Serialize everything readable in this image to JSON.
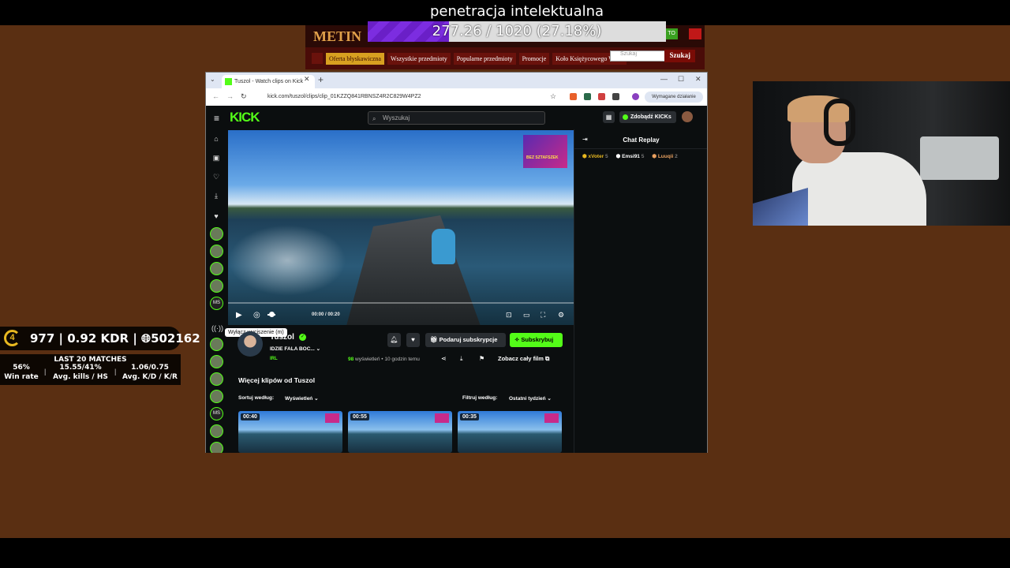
{
  "stream_title": "penetracja intelektualna",
  "goal": {
    "text": "277.26 / 1020 (27.18%)",
    "progress_percent": 27.18
  },
  "shop": {
    "logo": "METIN",
    "nav": [
      "Oferta błyskawiczna",
      "Wszystkie przedmioty",
      "Popularne przedmioty",
      "Promocje",
      "Koło Księżycowego Wilka"
    ],
    "search_placeholder": "Szukaj",
    "search_button": "Szukaj",
    "green_badge": "TO"
  },
  "browser": {
    "tab_title": "Tuszol - Watch clips on Kick",
    "url": "kick.com/tuszol/clips/clip_01KZZQ841RBNSZ4R2C829W4PZ2",
    "required_action": "Wymagane działanie"
  },
  "kick": {
    "logo": "KICK",
    "search_placeholder": "Wyszukaj",
    "get_kicks": "Zdobądź KICKs",
    "tooltip": "Wyłącz wyciszenie (m)",
    "time": "00:00 / 00:20",
    "ad_text": "BEZ SZTAFSZEK",
    "chat_title": "Chat Replay",
    "chat_badges": [
      {
        "name": "xVoter",
        "count": "5",
        "color": "#e8b820"
      },
      {
        "name": "Emsi91",
        "count": "5",
        "color": "#ffffff"
      },
      {
        "name": "Luuqii",
        "count": "2",
        "color": "#e8a060"
      }
    ],
    "channel": {
      "name": "Tuszol",
      "title": "IDZIE FALA BOC...",
      "category": "IRL"
    },
    "gift_label": "Podaruj subskrypcje",
    "subscribe_label": "Subskrybuj",
    "views_count": "98",
    "views_label": "wyświetleń",
    "posted": "• 10 godzin temu",
    "full_film": "Zobacz cały film",
    "more_clips": "Więcej klipów od Tuszol",
    "sort_label": "Sortuj według:",
    "sort_value": "Wyświetleń",
    "filter_label": "Filtruj według:",
    "filter_value": "Ostatni tydzień",
    "clips": [
      {
        "duration": "00:40"
      },
      {
        "duration": "00:55"
      },
      {
        "duration": "00:35"
      }
    ]
  },
  "stats": {
    "level": "4",
    "elo": "977",
    "kdr": "0.92 KDR",
    "rank": "502162",
    "header": "LAST 20 MATCHES",
    "win_rate": "56%",
    "win_rate_label": "Win rate",
    "kills_hs": "15.55/41%",
    "kills_hs_label": "Avg. kills / HS",
    "kd_kr": "1.06/0.75",
    "kd_kr_label": "Avg. K/D / K/R"
  }
}
